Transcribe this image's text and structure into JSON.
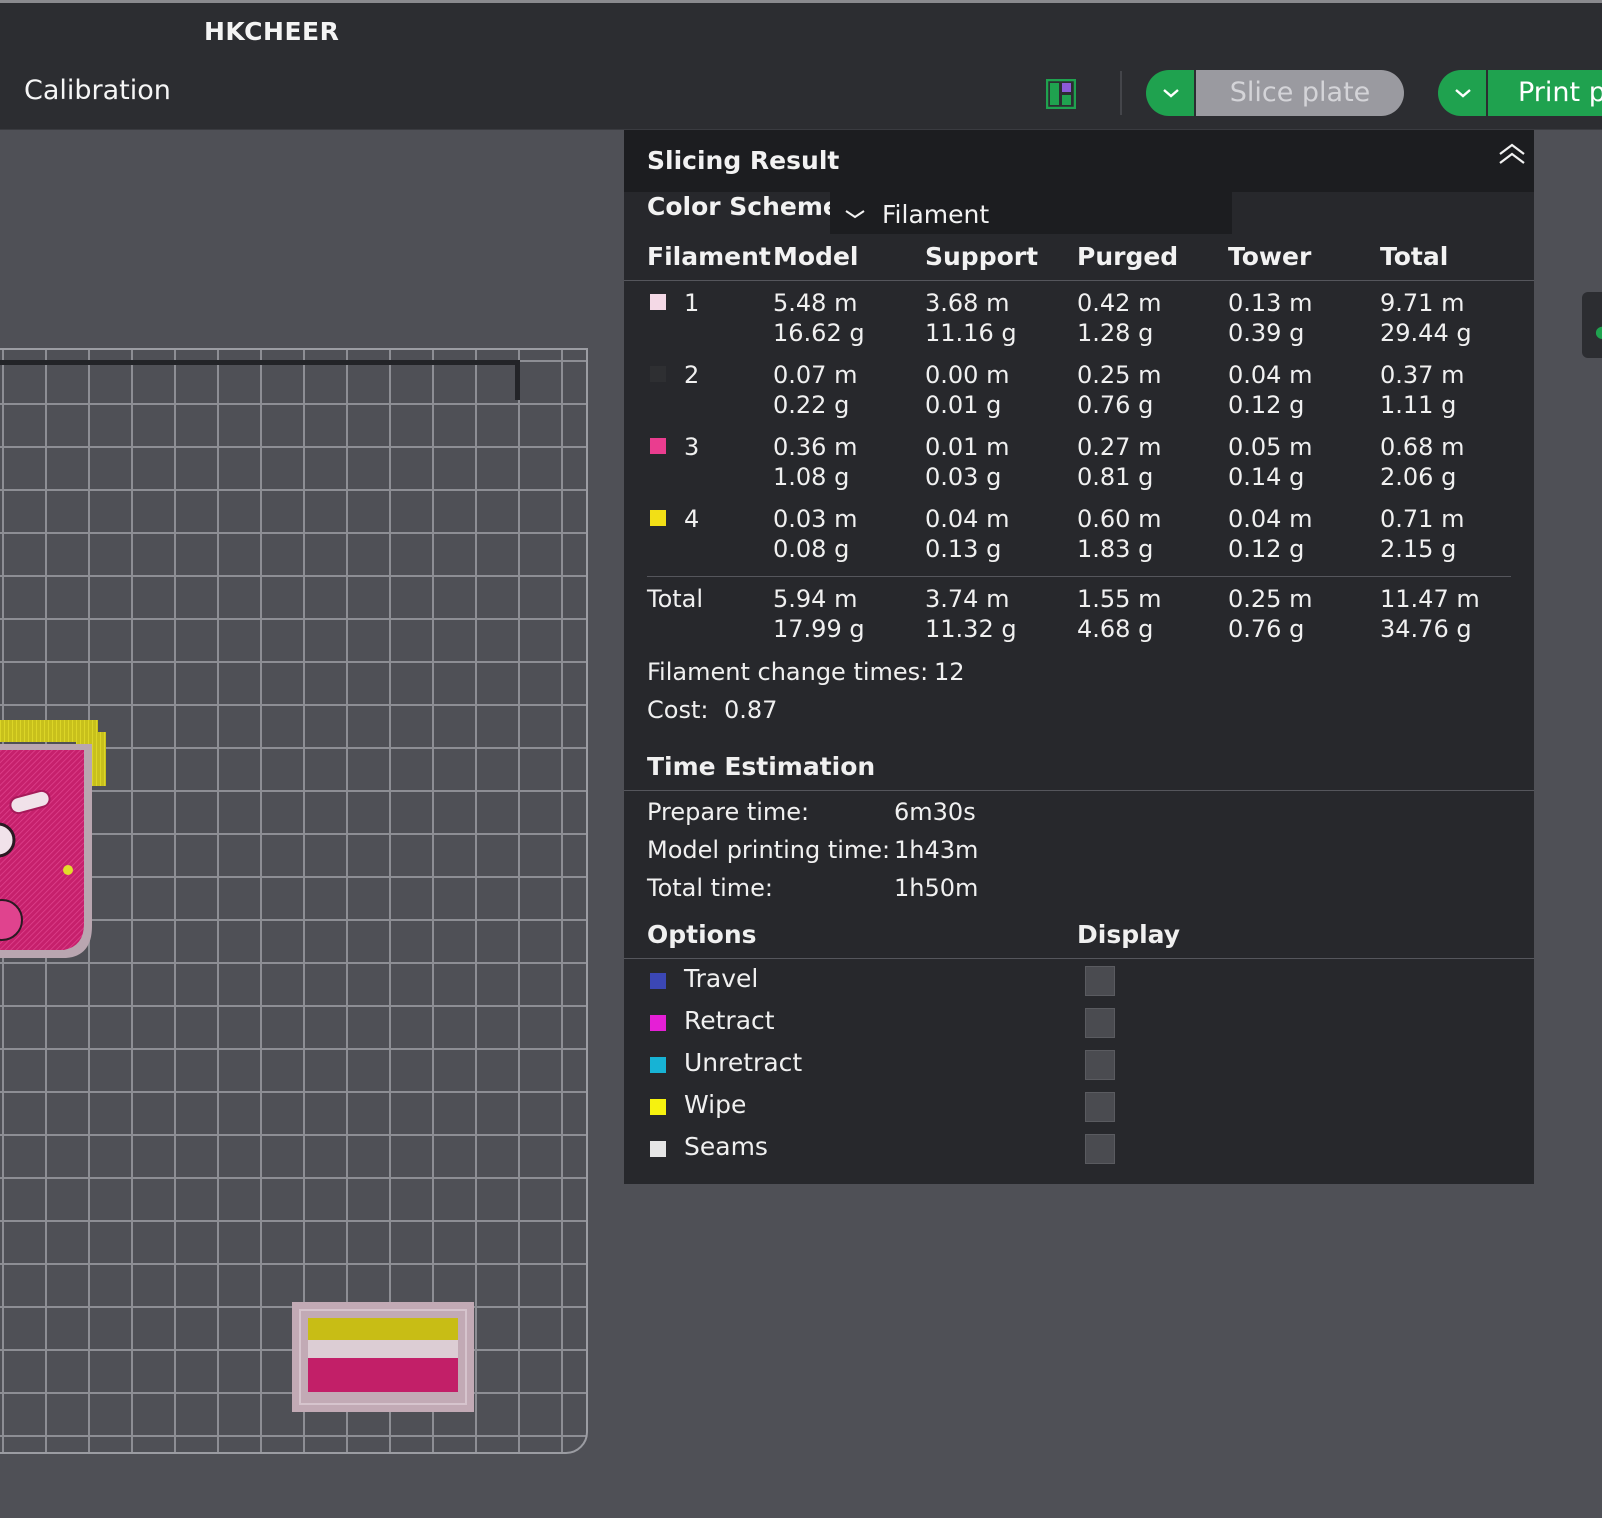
{
  "app": {
    "brand": "HKCHEER"
  },
  "toolbar": {
    "calibration": "Calibration",
    "slice_label": "Slice plate",
    "print_label": "Print p"
  },
  "panel": {
    "title": "Slicing Result",
    "color_scheme_label": "Color Scheme",
    "color_scheme_value": "Filament",
    "headers": [
      "Filament",
      "Model",
      "Support",
      "Purged",
      "Tower",
      "Total"
    ],
    "rows": [
      {
        "id": "1",
        "color": "#f4d9e6",
        "model": [
          "5.48 m",
          "16.62 g"
        ],
        "support": [
          "3.68 m",
          "11.16 g"
        ],
        "purged": [
          "0.42 m",
          "1.28 g"
        ],
        "tower": [
          "0.13 m",
          "0.39 g"
        ],
        "total": [
          "9.71 m",
          "29.44 g"
        ]
      },
      {
        "id": "2",
        "color": "#2e2f32",
        "model": [
          "0.07 m",
          "0.22 g"
        ],
        "support": [
          "0.00 m",
          "0.01 g"
        ],
        "purged": [
          "0.25 m",
          "0.76 g"
        ],
        "tower": [
          "0.04 m",
          "0.12 g"
        ],
        "total": [
          "0.37 m",
          "1.11 g"
        ]
      },
      {
        "id": "3",
        "color": "#ea3d8f",
        "model": [
          "0.36 m",
          "1.08 g"
        ],
        "support": [
          "0.01 m",
          "0.03 g"
        ],
        "purged": [
          "0.27 m",
          "0.81 g"
        ],
        "tower": [
          "0.05 m",
          "0.14 g"
        ],
        "total": [
          "0.68 m",
          "2.06 g"
        ]
      },
      {
        "id": "4",
        "color": "#f2df16",
        "model": [
          "0.03 m",
          "0.08 g"
        ],
        "support": [
          "0.04 m",
          "0.13 g"
        ],
        "purged": [
          "0.60 m",
          "1.83 g"
        ],
        "tower": [
          "0.04 m",
          "0.12 g"
        ],
        "total": [
          "0.71 m",
          "2.15 g"
        ]
      }
    ],
    "totals": {
      "label": "Total",
      "model": [
        "5.94 m",
        "17.99 g"
      ],
      "support": [
        "3.74 m",
        "11.32 g"
      ],
      "purged": [
        "1.55 m",
        "4.68 g"
      ],
      "tower": [
        "0.25 m",
        "0.76 g"
      ],
      "total": [
        "11.47 m",
        "34.76 g"
      ]
    },
    "filament_change_label": "Filament change times:",
    "filament_change_value": "12",
    "cost_label": "Cost:",
    "cost_value": "0.87",
    "time_title": "Time Estimation",
    "times": [
      {
        "label": "Prepare time:",
        "value": "6m30s"
      },
      {
        "label": "Model printing time:",
        "value": "1h43m"
      },
      {
        "label": "Total time:",
        "value": "1h50m"
      }
    ],
    "options_title": "Options",
    "display_title": "Display",
    "options": [
      {
        "label": "Travel",
        "color": "#3b47b5"
      },
      {
        "label": "Retract",
        "color": "#e51fd6"
      },
      {
        "label": "Unretract",
        "color": "#17b3d5"
      },
      {
        "label": "Wipe",
        "color": "#f6f20f"
      },
      {
        "label": "Seams",
        "color": "#e6e6e6"
      }
    ]
  }
}
